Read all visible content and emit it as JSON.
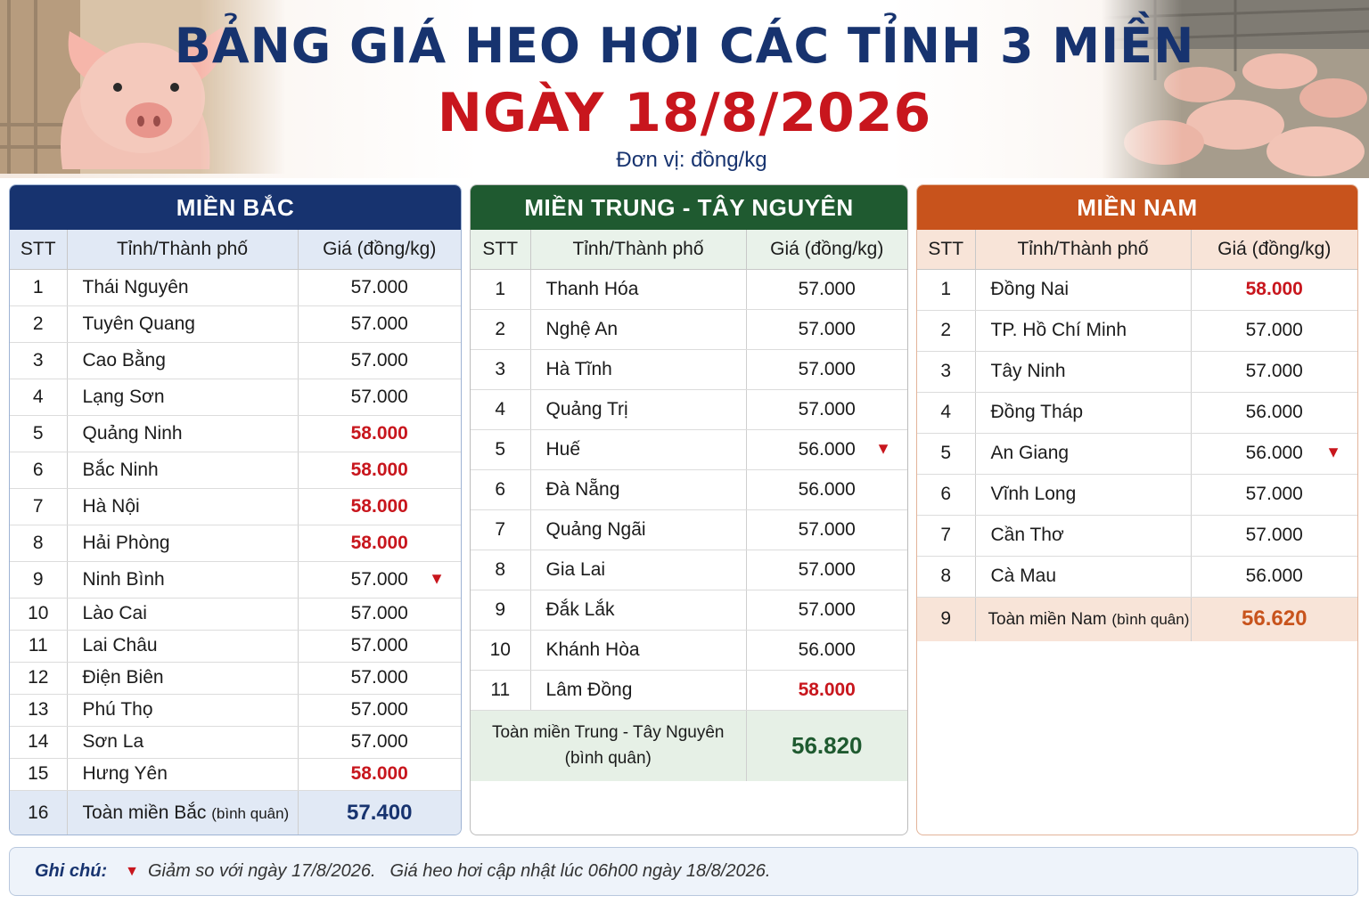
{
  "header": {
    "title": "BẢNG GIÁ HEO HƠI CÁC TỈNH 3 MIỀN",
    "date": "NGÀY 18/8/2026",
    "unit": "Đơn vị: đồng/kg"
  },
  "columns": {
    "stt": "STT",
    "province": "Tỉnh/Thành phố",
    "price": "Giá (đồng/kg)"
  },
  "colors": {
    "north": "#17336f",
    "central": "#1f5a30",
    "south": "#c8531c",
    "increase": "#c8161d"
  },
  "mien_bac": {
    "title": "MIỀN BẮC",
    "rows": [
      {
        "stt": "1",
        "name": "Thái Nguyên",
        "price": "57.000",
        "status": "normal"
      },
      {
        "stt": "2",
        "name": "Tuyên Quang",
        "price": "57.000",
        "status": "normal"
      },
      {
        "stt": "3",
        "name": "Cao Bằng",
        "price": "57.000",
        "status": "normal"
      },
      {
        "stt": "4",
        "name": "Lạng Sơn",
        "price": "57.000",
        "status": "normal"
      },
      {
        "stt": "5",
        "name": "Quảng Ninh",
        "price": "58.000",
        "status": "up"
      },
      {
        "stt": "6",
        "name": "Bắc Ninh",
        "price": "58.000",
        "status": "up"
      },
      {
        "stt": "7",
        "name": "Hà Nội",
        "price": "58.000",
        "status": "up"
      },
      {
        "stt": "8",
        "name": "Hải Phòng",
        "price": "58.000",
        "status": "up"
      },
      {
        "stt": "9",
        "name": "Ninh Bình",
        "price": "57.000",
        "status": "down"
      },
      {
        "stt": "10",
        "name": "Lào Cai",
        "price": "57.000",
        "status": "normal"
      },
      {
        "stt": "11",
        "name": "Lai Châu",
        "price": "57.000",
        "status": "normal"
      },
      {
        "stt": "12",
        "name": "Điện Biên",
        "price": "57.000",
        "status": "normal"
      },
      {
        "stt": "13",
        "name": "Phú Thọ",
        "price": "57.000",
        "status": "normal"
      },
      {
        "stt": "14",
        "name": "Sơn La",
        "price": "57.000",
        "status": "normal"
      },
      {
        "stt": "15",
        "name": "Hưng Yên",
        "price": "58.000",
        "status": "up"
      }
    ],
    "average": {
      "stt": "16",
      "label": "Toàn miền Bắc",
      "note": "(bình quân)",
      "price": "57.400"
    }
  },
  "mien_trung": {
    "title": "MIỀN TRUNG - TÂY NGUYÊN",
    "rows": [
      {
        "stt": "1",
        "name": "Thanh Hóa",
        "price": "57.000",
        "status": "normal"
      },
      {
        "stt": "2",
        "name": "Nghệ An",
        "price": "57.000",
        "status": "normal"
      },
      {
        "stt": "3",
        "name": "Hà Tĩnh",
        "price": "57.000",
        "status": "normal"
      },
      {
        "stt": "4",
        "name": "Quảng Trị",
        "price": "57.000",
        "status": "normal"
      },
      {
        "stt": "5",
        "name": "Huế",
        "price": "56.000",
        "status": "down"
      },
      {
        "stt": "6",
        "name": "Đà Nẵng",
        "price": "56.000",
        "status": "normal"
      },
      {
        "stt": "7",
        "name": "Quảng Ngãi",
        "price": "57.000",
        "status": "normal"
      },
      {
        "stt": "8",
        "name": "Gia Lai",
        "price": "57.000",
        "status": "normal"
      },
      {
        "stt": "9",
        "name": "Đắk Lắk",
        "price": "57.000",
        "status": "normal"
      },
      {
        "stt": "10",
        "name": "Khánh Hòa",
        "price": "56.000",
        "status": "normal"
      },
      {
        "stt": "11",
        "name": "Lâm Đồng",
        "price": "58.000",
        "status": "up"
      }
    ],
    "average": {
      "label": "Toàn miền Trung - Tây Nguyên",
      "note": "(bình quân)",
      "price": "56.820"
    }
  },
  "mien_nam": {
    "title": "MIỀN NAM",
    "rows": [
      {
        "stt": "1",
        "name": "Đồng Nai",
        "price": "58.000",
        "status": "up"
      },
      {
        "stt": "2",
        "name": "TP. Hồ Chí Minh",
        "price": "57.000",
        "status": "normal"
      },
      {
        "stt": "3",
        "name": "Tây Ninh",
        "price": "57.000",
        "status": "normal"
      },
      {
        "stt": "4",
        "name": "Đồng Tháp",
        "price": "56.000",
        "status": "normal"
      },
      {
        "stt": "5",
        "name": "An Giang",
        "price": "56.000",
        "status": "down"
      },
      {
        "stt": "6",
        "name": "Vĩnh Long",
        "price": "57.000",
        "status": "normal"
      },
      {
        "stt": "7",
        "name": "Cần Thơ",
        "price": "57.000",
        "status": "normal"
      },
      {
        "stt": "8",
        "name": "Cà Mau",
        "price": "56.000",
        "status": "normal"
      }
    ],
    "average": {
      "stt": "9",
      "label": "Toàn miền Nam",
      "note": "(bình quân)",
      "price": "56.620"
    }
  },
  "note": {
    "label": "Ghi chú:",
    "icon": "down-triangle-icon",
    "text1": "Giảm so với ngày 17/8/2026.",
    "text2": "Giá heo hơi cập nhật lúc 06h00 ngày 18/8/2026."
  }
}
